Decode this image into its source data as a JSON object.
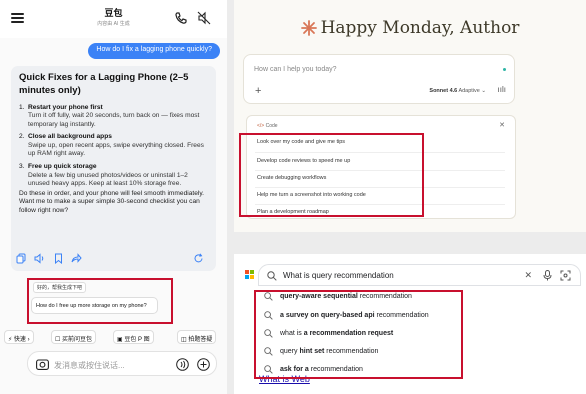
{
  "chat": {
    "brand_name": "豆包",
    "brand_sub": "内容由 AI 生成",
    "user_message": "How do I fix a lagging phone quickly?",
    "answer_title": "Quick Fixes for a Lagging Phone (2–5 minutes only)",
    "tips": [
      {
        "num": "1.",
        "title": "Restart your phone first",
        "desc": "Turn it off fully, wait 20 seconds, turn back on — fixes most temporary lag instantly."
      },
      {
        "num": "2.",
        "title": "Close all background apps",
        "desc": "Swipe up, open recent apps, swipe everything closed. Frees up RAM right away."
      },
      {
        "num": "3.",
        "title": "Free up quick storage",
        "desc": "Delete a few big unused photos/videos or uninstall 1–2 unused heavy apps. Keep at least 10% storage free."
      }
    ],
    "answer_outro": "Do these in order, and your phone will feel smooth immediately. Want me to make a super simple 30-second checklist you can follow right now?",
    "suggestion_short": "好的，帮我生成下吧",
    "suggestion_long": "How do I free up more storage on my phone?",
    "chips": [
      "快速",
      "买前问豆包",
      "豆包 P 图",
      "拍题答疑"
    ],
    "input_placeholder": "发消息或按住说话..."
  },
  "claude": {
    "greeting": "Happy Monday, Author",
    "prompt_placeholder": "How can I help you today?",
    "model_name": "Sonnet 4.6",
    "model_mode": "Adaptive",
    "code_tag": "</>",
    "code_label": "Code",
    "code_items": [
      "Look over my code and give me tips",
      "Develop code reviews to speed me up",
      "Create debugging workflows",
      "Help me turn a screenshot into working code",
      "Plan a development roadmap"
    ],
    "accent_color": "#d97757"
  },
  "google": {
    "query": "What is query recommendation",
    "suggestions": [
      {
        "bold_first": true,
        "a": "query-aware sequential",
        "b": " recommendation"
      },
      {
        "bold_first": true,
        "a": "a survey on query-based api",
        "b": " recommendation"
      },
      {
        "bold_first": false,
        "a": "what is ",
        "b": "a recommendation request"
      },
      {
        "bold_first": false,
        "a": "query ",
        "b": "hint set",
        "c": " recommendation"
      },
      {
        "bold_first": true,
        "a": "ask for a",
        "b": " recommendation"
      }
    ],
    "footer_link": "What is Web"
  },
  "highlight_color": "#c8102e"
}
